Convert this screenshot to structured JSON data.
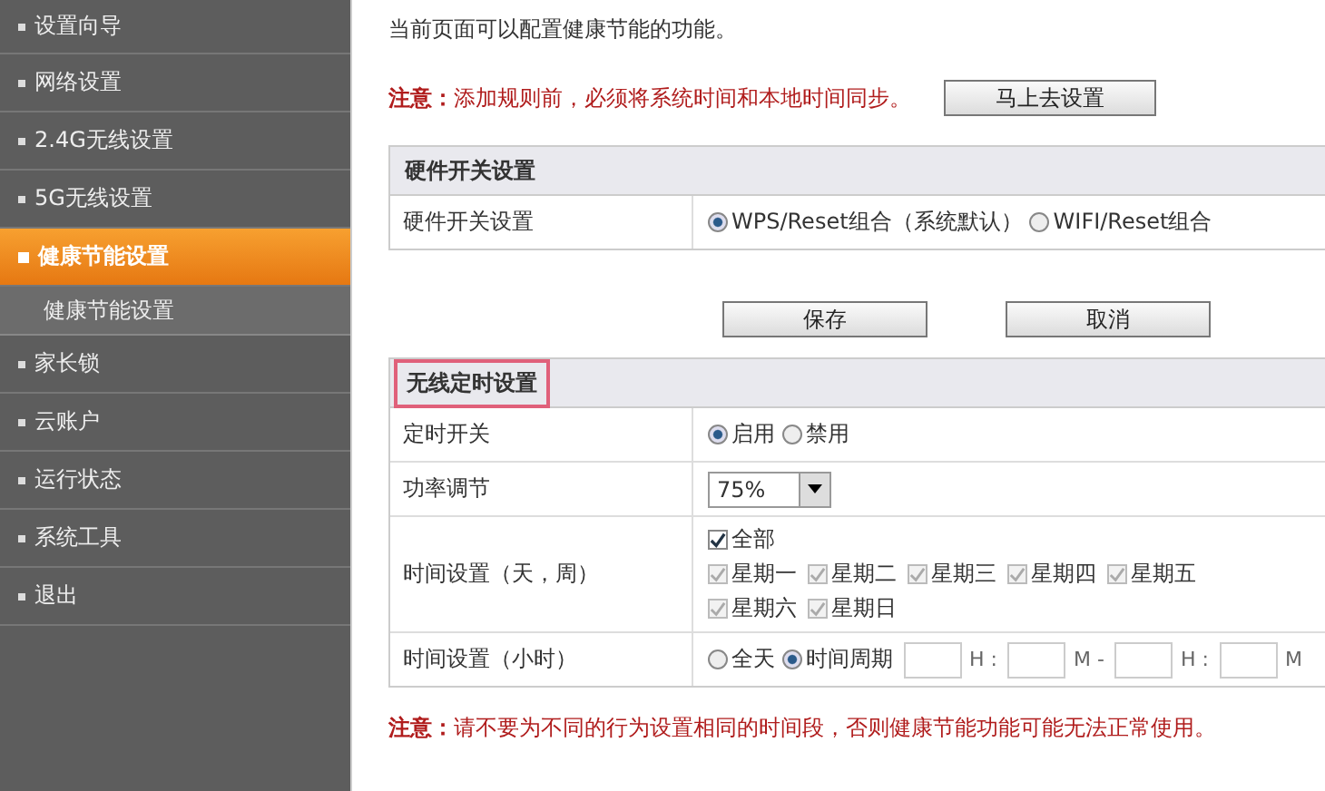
{
  "sidebar": {
    "items": [
      {
        "label": "设置向导",
        "selected": false
      },
      {
        "label": "网络设置",
        "selected": false
      },
      {
        "label": "2.4G无线设置",
        "selected": false
      },
      {
        "label": "5G无线设置",
        "selected": false
      },
      {
        "label": "健康节能设置",
        "selected": true,
        "children": [
          {
            "label": "健康节能设置",
            "selected": false
          }
        ]
      },
      {
        "label": "家长锁",
        "selected": false
      },
      {
        "label": "云账户",
        "selected": false
      },
      {
        "label": "运行状态",
        "selected": false
      },
      {
        "label": "系统工具",
        "selected": false
      },
      {
        "label": "退出",
        "selected": false
      }
    ]
  },
  "intro": "当前页面可以配置健康节能的功能。",
  "notice_top": {
    "label": "注意：",
    "text": "添加规则前，必须将系统时间和本地时间同步。",
    "button": "马上去设置"
  },
  "hardware": {
    "title": "硬件开关设置",
    "label": "硬件开关设置",
    "options": [
      {
        "label": "WPS/Reset组合（系统默认）",
        "selected": true
      },
      {
        "label": "WIFI/Reset组合",
        "selected": false
      }
    ]
  },
  "buttons": [
    "保存",
    "取消"
  ],
  "schedule": {
    "title": "无线定时设置",
    "rows": [
      {
        "kind": "radio",
        "label": "定时开关",
        "options": [
          {
            "label": "启用",
            "selected": true
          },
          {
            "label": "禁用",
            "selected": false
          }
        ]
      },
      {
        "kind": "select",
        "label": "功率调节",
        "value": "75%"
      },
      {
        "kind": "days",
        "label": "时间设置（天，周）",
        "all": {
          "label": "全部",
          "checked": true
        },
        "days": [
          {
            "label": "星期一",
            "checked": true,
            "disabled": true
          },
          {
            "label": "星期二",
            "checked": true,
            "disabled": true
          },
          {
            "label": "星期三",
            "checked": true,
            "disabled": true
          },
          {
            "label": "星期四",
            "checked": true,
            "disabled": true
          },
          {
            "label": "星期五",
            "checked": true,
            "disabled": true
          },
          {
            "label": "星期六",
            "checked": true,
            "disabled": true
          },
          {
            "label": "星期日",
            "checked": true,
            "disabled": true
          }
        ]
      },
      {
        "kind": "time",
        "label": "时间设置（小时）",
        "options": [
          {
            "label": "全天",
            "selected": false
          },
          {
            "label": "时间周期",
            "selected": true
          }
        ],
        "units": [
          "H :",
          "M -",
          "H :",
          "M"
        ]
      }
    ]
  },
  "notice_bottom": {
    "label": "注意：",
    "text": "请不要为不同的行为设置相同的时间段，否则健康节能功能可能无法正常使用。"
  }
}
